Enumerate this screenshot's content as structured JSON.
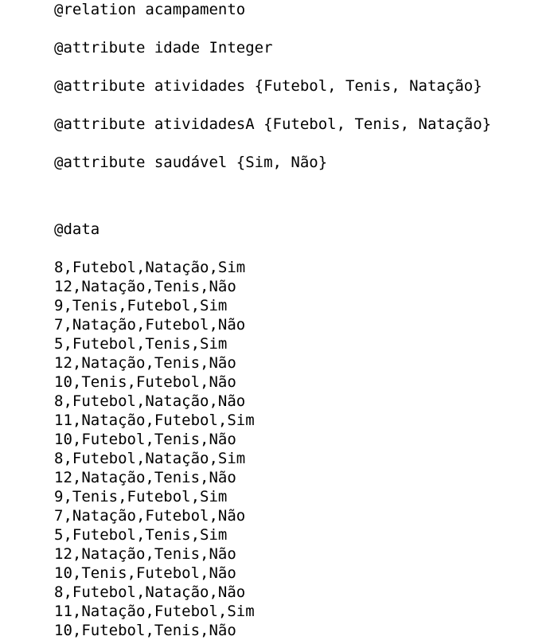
{
  "relation": "@relation acampamento",
  "attributes": [
    "@attribute idade Integer",
    "@attribute atividades {Futebol, Tenis, Natação}",
    "@attribute atividadesA {Futebol, Tenis, Natação}",
    "@attribute saudável {Sim, Não}"
  ],
  "data_keyword": "@data",
  "rows": [
    "8,Futebol,Natação,Sim",
    "12,Natação,Tenis,Não",
    "9,Tenis,Futebol,Sim",
    "7,Natação,Futebol,Não",
    "5,Futebol,Tenis,Sim",
    "12,Natação,Tenis,Não",
    "10,Tenis,Futebol,Não",
    "8,Futebol,Natação,Não",
    "11,Natação,Futebol,Sim",
    "10,Futebol,Tenis,Não",
    "8,Futebol,Natação,Sim",
    "12,Natação,Tenis,Não",
    "9,Tenis,Futebol,Sim",
    "7,Natação,Futebol,Não",
    "5,Futebol,Tenis,Sim",
    "12,Natação,Tenis,Não",
    "10,Tenis,Futebol,Não",
    "8,Futebol,Natação,Não",
    "11,Natação,Futebol,Sim",
    "10,Futebol,Tenis,Não"
  ]
}
